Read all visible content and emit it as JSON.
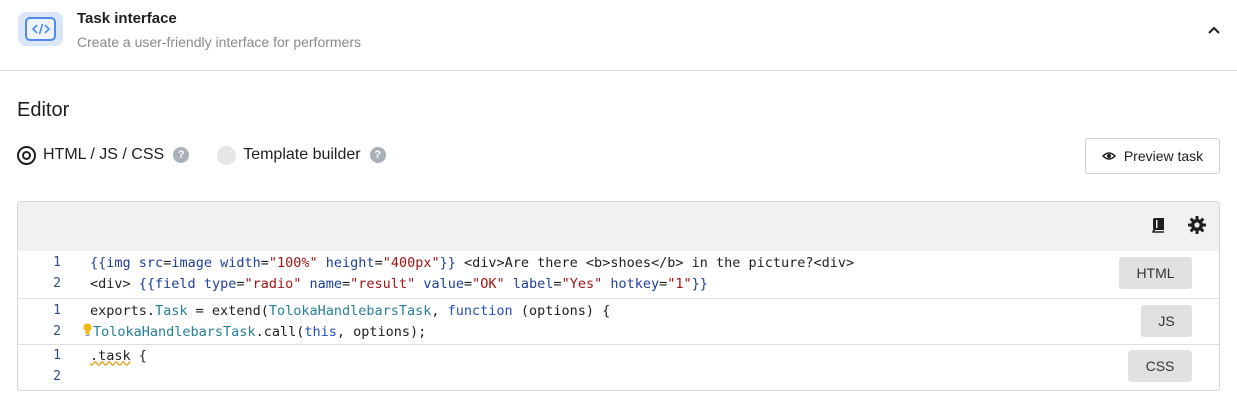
{
  "header": {
    "title": "Task interface",
    "subtitle": "Create a user-friendly interface for performers"
  },
  "editor": {
    "title": "Editor",
    "mode_options": [
      {
        "label": "HTML / JS / CSS",
        "selected": true
      },
      {
        "label": "Template builder",
        "selected": false
      }
    ],
    "preview_label": "Preview task"
  },
  "code": {
    "html": {
      "badge": "HTML",
      "lines": [
        {
          "n": "1",
          "text": "{{img src=image width=\"100%\" height=\"400px\"}} <div>Are there <b>shoes</b> in the picture?<div>"
        },
        {
          "n": "2",
          "text": "<div> {{field type=\"radio\" name=\"result\" value=\"OK\" label=\"Yes\" hotkey=\"1\"}}"
        }
      ]
    },
    "js": {
      "badge": "JS",
      "lines": [
        {
          "n": "1",
          "text": "exports.Task = extend(TolokaHandlebarsTask, function (options) {"
        },
        {
          "n": "2",
          "text": "TolokaHandlebarsTask.call(this, options);"
        }
      ]
    },
    "css": {
      "badge": "CSS",
      "lines": [
        {
          "n": "1",
          "text": ".task {"
        },
        {
          "n": "2",
          "text": ""
        }
      ]
    }
  },
  "colors": {
    "accent": "#4f8af0",
    "toolbar_bg": "#f0f1f3",
    "badge_bg": "#e1e1e1"
  }
}
